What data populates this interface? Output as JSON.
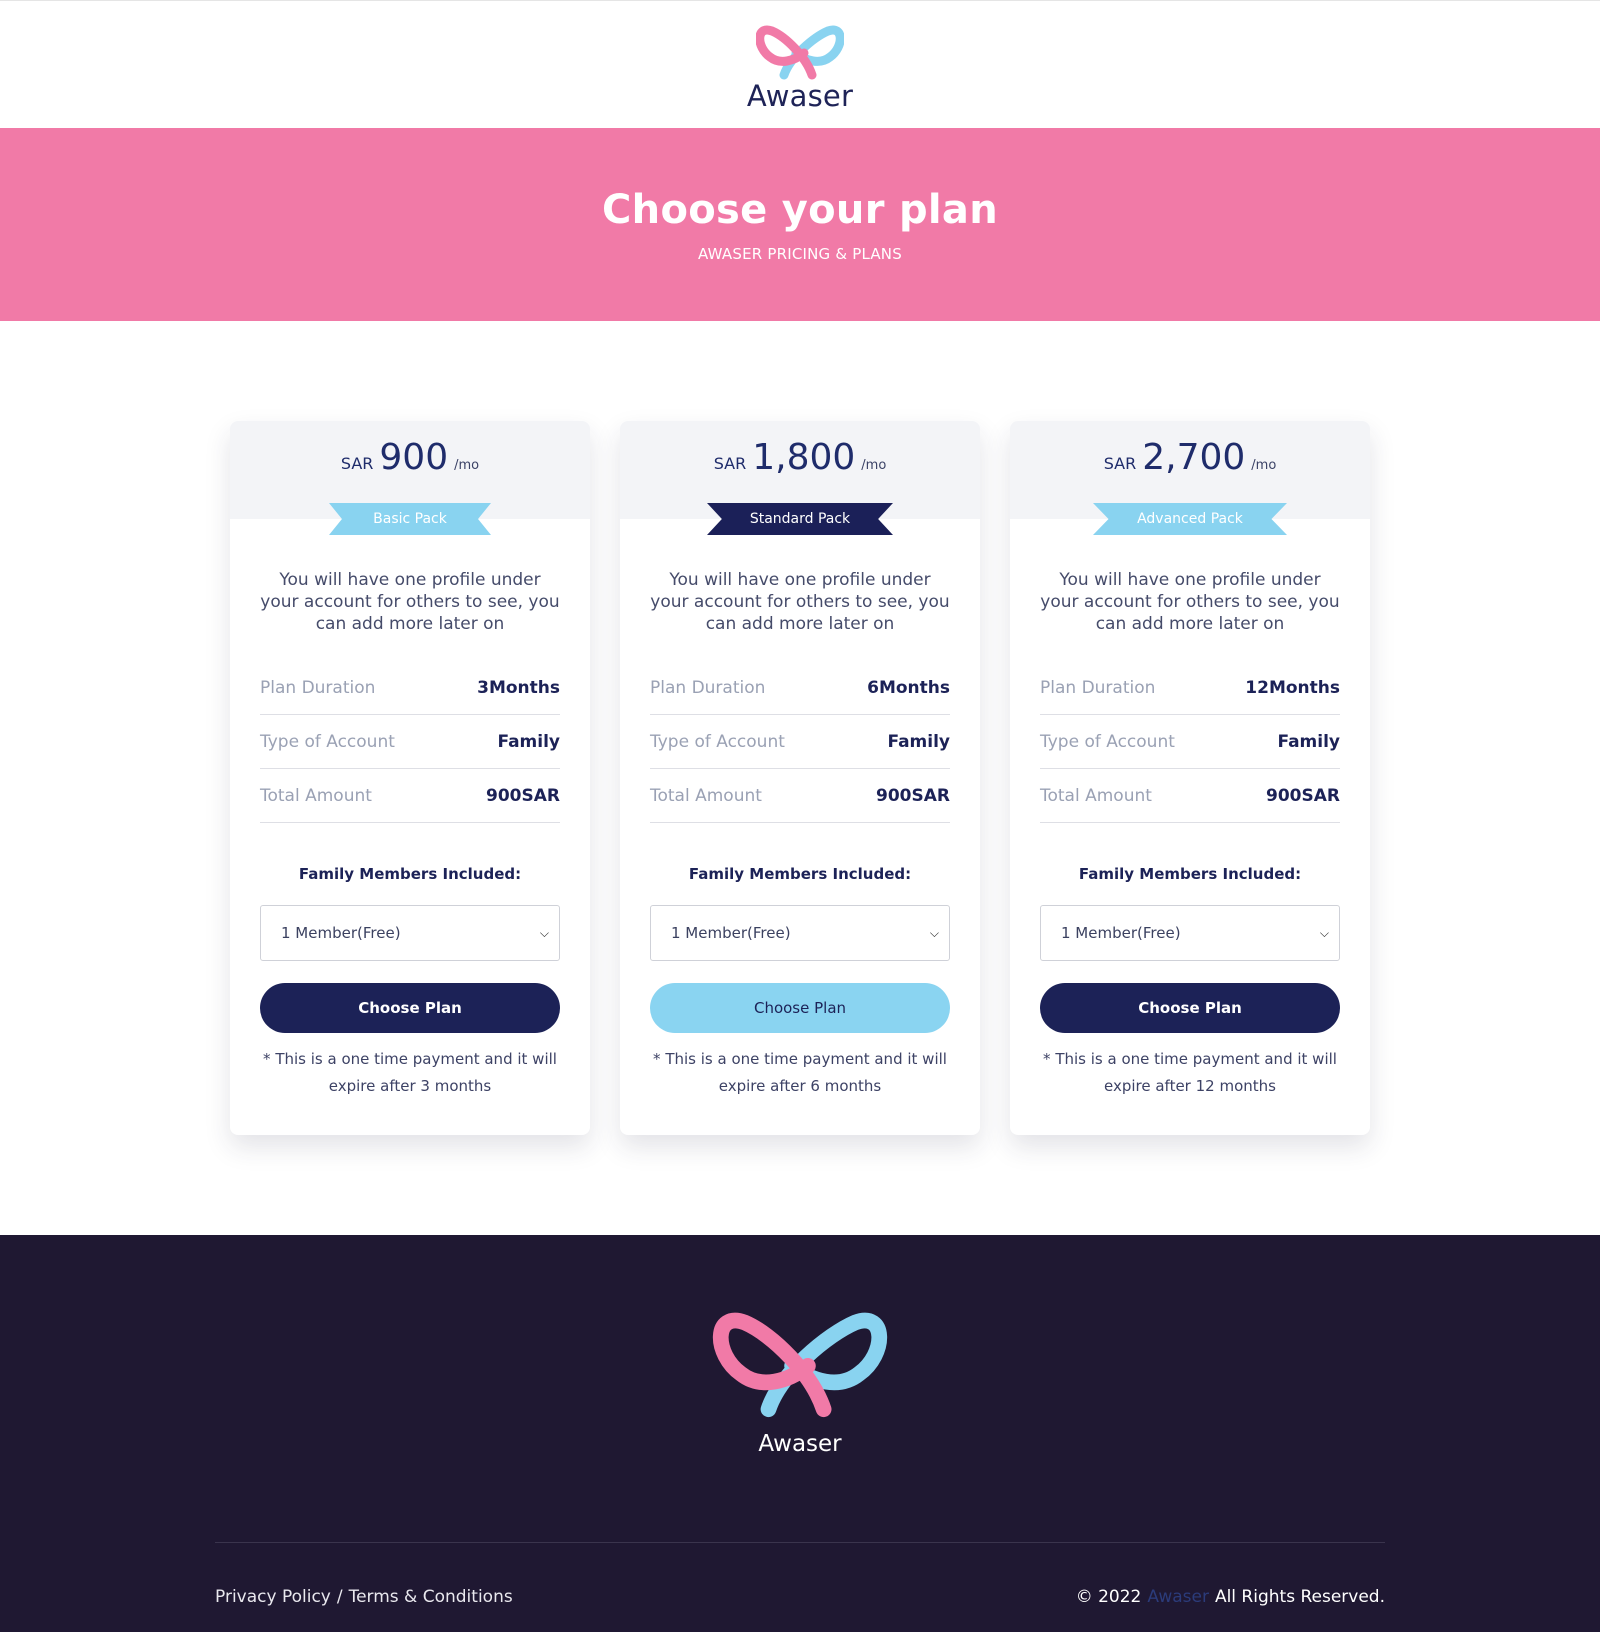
{
  "header": {
    "brand_name": "Awaser"
  },
  "hero": {
    "title": "Choose your plan",
    "subtitle": "AWASER PRICING & PLANS"
  },
  "plans": [
    {
      "currency": "SAR",
      "amount": "900",
      "per": "/mo",
      "badge": "Basic Pack",
      "description": "You will have one profile under your account for others to see, you can add more later on",
      "rows": [
        {
          "label": "Plan Duration",
          "value": "3Months"
        },
        {
          "label": "Type of Account",
          "value": "Family"
        },
        {
          "label": "Total Amount",
          "value": "900SAR"
        }
      ],
      "members_label": "Family Members Included:",
      "members_selected": "1 Member(Free)",
      "button": "Choose Plan",
      "note": "* This is a one time payment and it will expire after 3 months"
    },
    {
      "currency": "SAR",
      "amount": "1,800",
      "per": "/mo",
      "badge": "Standard Pack",
      "description": "You will have one profile under your account for others to see, you can add more later on",
      "rows": [
        {
          "label": "Plan Duration",
          "value": "6Months"
        },
        {
          "label": "Type of Account",
          "value": "Family"
        },
        {
          "label": "Total Amount",
          "value": "900SAR"
        }
      ],
      "members_label": "Family Members Included:",
      "members_selected": "1 Member(Free)",
      "button": "Choose Plan",
      "note": "* This is a one time payment and it will expire after 6 months"
    },
    {
      "currency": "SAR",
      "amount": "2,700",
      "per": "/mo",
      "badge": "Advanced Pack",
      "description": "You will have one profile under your account for others to see, you can add more later on",
      "rows": [
        {
          "label": "Plan Duration",
          "value": "12Months"
        },
        {
          "label": "Type of Account",
          "value": "Family"
        },
        {
          "label": "Total Amount",
          "value": "900SAR"
        }
      ],
      "members_label": "Family Members Included:",
      "members_selected": "1 Member(Free)",
      "button": "Choose Plan",
      "note": "* This is a one time payment and it will expire after 12 months"
    }
  ],
  "footer": {
    "brand_name": "Awaser",
    "privacy": "Privacy Policy",
    "separator": "/",
    "terms": "Terms & Conditions",
    "copyright_prefix": "© 2022",
    "copyright_brand": "Awaser",
    "copyright_suffix": "All Rights Reserved."
  },
  "colors": {
    "pink": "#f17aa7",
    "light_blue": "#8ad4f1",
    "navy": "#1c2257",
    "footer_bg": "#1f1832"
  },
  "icons": {
    "logo": "awaser-logo-icon",
    "select_caret": "chevron-down-icon"
  }
}
